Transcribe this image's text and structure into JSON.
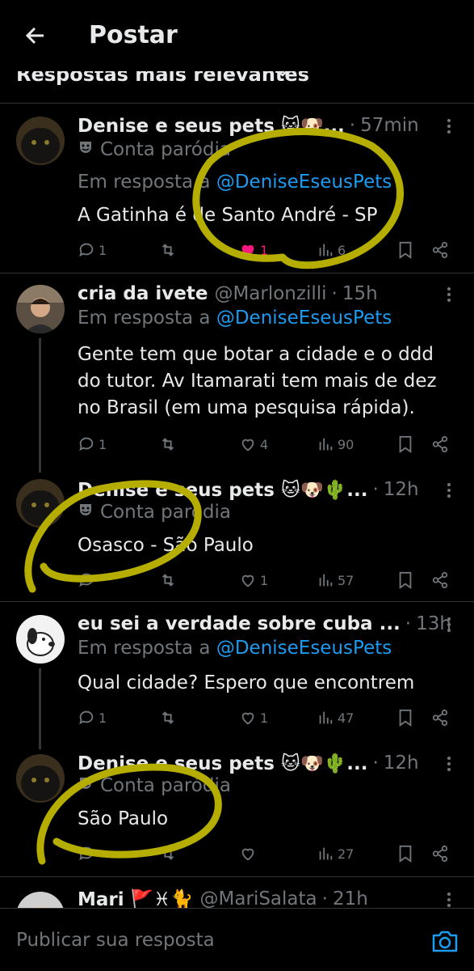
{
  "header": {
    "title": "Postar",
    "back_icon": "arrow-left-icon"
  },
  "sort": {
    "label": "Respostas mais relevantes"
  },
  "posts": [
    {
      "name": "Denise e seus pets 🐱🐶...",
      "handle": "",
      "time": "57min",
      "parody": "Conta paródia",
      "reply_prefix": "Em resposta a ",
      "reply_to": "@DeniseEseusPets",
      "text": [
        "A Gatinha é de Santo André  - SP"
      ],
      "replies": "1",
      "reposts": "",
      "likes": "1",
      "views": "6",
      "liked": true
    },
    {
      "name": "cria da ivete",
      "handle": "@Marlonzilli",
      "time": "15h",
      "reply_prefix": "Em resposta a ",
      "reply_to": "@DeniseEseusPets",
      "text": [
        "Gente tem que botar a cidade e o ddd",
        "do tutor. Av Itamarati tem mais de dez",
        "no Brasil (em uma pesquisa rápida)."
      ],
      "replies": "1",
      "reposts": "",
      "likes": "4",
      "views": "90"
    },
    {
      "name": "Denise e seus pets 🐱🐶🌵...",
      "handle": "",
      "time": "12h",
      "parody": "Conta paródia",
      "text": [
        "Osasco - São Paulo"
      ],
      "replies": "",
      "reposts": "",
      "likes": "1",
      "views": "57"
    },
    {
      "name": "eu sei a verdade sobre cuba ...",
      "handle": "",
      "time": "13h",
      "reply_prefix": "Em resposta a ",
      "reply_to": "@DeniseEseusPets",
      "text": [
        "Qual cidade? Espero que encontrem"
      ],
      "replies": "1",
      "reposts": "",
      "likes": "1",
      "views": "47"
    },
    {
      "name": "Denise e seus pets 🐱🐶🌵...",
      "handle": "",
      "time": "12h",
      "parody": "Conta paródia",
      "text": [
        "São Paulo"
      ],
      "replies": "",
      "reposts": "",
      "likes": "",
      "views": "27"
    },
    {
      "name": "Mari 🚩♓🐈",
      "handle": "@MariSalata",
      "time": "21h"
    }
  ],
  "reply_box": {
    "placeholder": "Publicar sua resposta",
    "camera_icon": "camera-icon"
  },
  "colors": {
    "background": "#000000",
    "text": "#e7e9ea",
    "muted": "#71767b",
    "link": "#1d9bf0",
    "like": "#f91880",
    "annotation": "#b5ad00"
  }
}
